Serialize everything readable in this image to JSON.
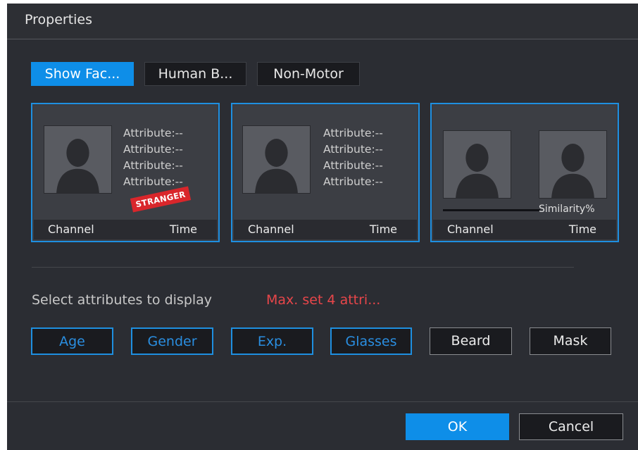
{
  "dialog": {
    "title": "Properties"
  },
  "tabs": [
    {
      "label": "Show Fac...",
      "active": true
    },
    {
      "label": "Human B...",
      "active": false
    },
    {
      "label": "Non-Motor",
      "active": false
    }
  ],
  "cards": [
    {
      "attributes": [
        "Attribute:--",
        "Attribute:--",
        "Attribute:--",
        "Attribute:--"
      ],
      "stamp": "STRANGER",
      "channel": "Channel",
      "time": "Time"
    },
    {
      "attributes": [
        "Attribute:--",
        "Attribute:--",
        "Attribute:--",
        "Attribute:--"
      ],
      "channel": "Channel",
      "time": "Time"
    },
    {
      "similarity_label": "Similarity%",
      "channel": "Channel",
      "time": "Time"
    }
  ],
  "attribute_selection": {
    "label": "Select attributes to display",
    "hint": "Max. set 4 attri...",
    "hint_color": "#e8464a",
    "options": [
      {
        "label": "Age",
        "selected": true
      },
      {
        "label": "Gender",
        "selected": true
      },
      {
        "label": "Exp.",
        "selected": true
      },
      {
        "label": "Glasses",
        "selected": true
      },
      {
        "label": "Beard",
        "selected": false
      },
      {
        "label": "Mask",
        "selected": false
      }
    ]
  },
  "footer": {
    "ok_label": "OK",
    "cancel_label": "Cancel"
  },
  "colors": {
    "accent": "#0e8ee8",
    "background": "#2b2d33"
  }
}
